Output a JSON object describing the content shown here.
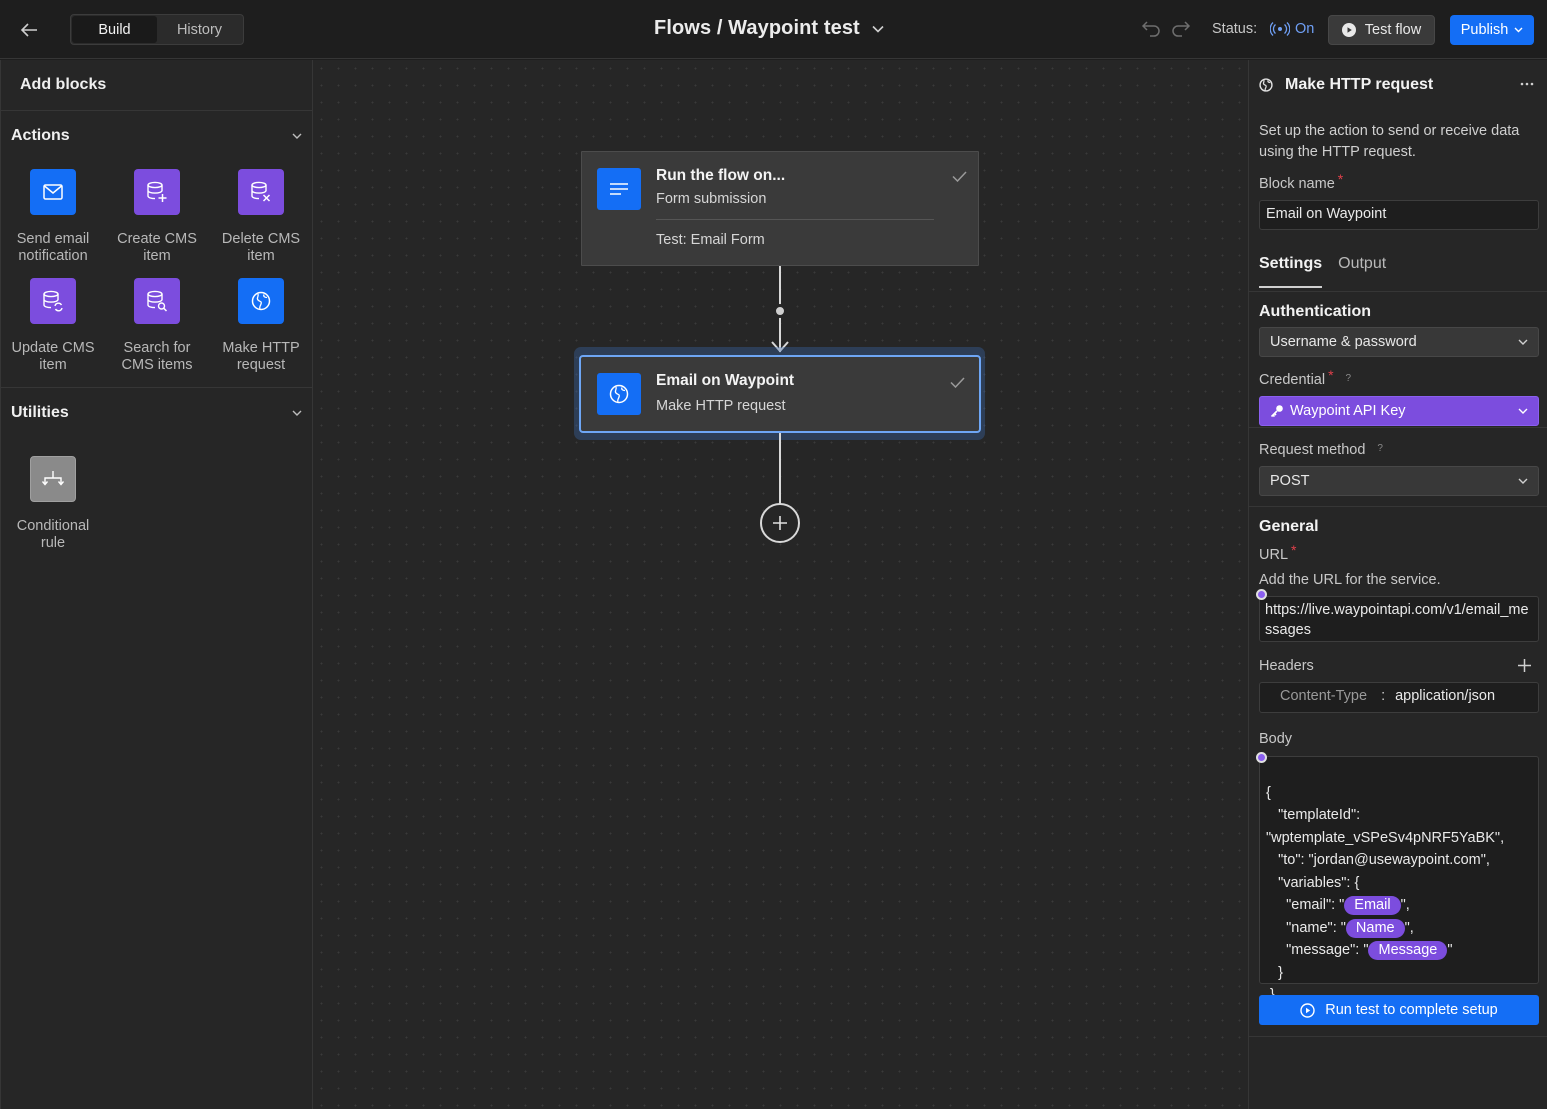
{
  "header": {
    "back_icon": "arrow-left-icon",
    "segments": [
      "Build",
      "History"
    ],
    "active_segment": "Build",
    "title": "Flows / Waypoint test",
    "status_label": "Status:",
    "status_value": "On",
    "test_flow_label": "Test flow",
    "publish_label": "Publish",
    "colors": {
      "accent_blue": "#146ef5",
      "status_on": "#6f9ff5"
    }
  },
  "left_panel": {
    "title": "Add blocks",
    "sections": [
      {
        "title": "Actions",
        "items": [
          {
            "label": "Send email notification",
            "icon": "mail-icon",
            "color": "#146ef5"
          },
          {
            "label": "Create CMS item",
            "icon": "database-plus-icon",
            "color": "#7c4dde"
          },
          {
            "label": "Delete CMS item",
            "icon": "database-x-icon",
            "color": "#7c4dde"
          },
          {
            "label": "Update CMS item",
            "icon": "database-refresh-icon",
            "color": "#7c4dde"
          },
          {
            "label": "Search for CMS items",
            "icon": "database-search-icon",
            "color": "#7c4dde"
          },
          {
            "label": "Make HTTP request",
            "icon": "globe-icon",
            "color": "#146ef5"
          }
        ]
      },
      {
        "title": "Utilities",
        "items": [
          {
            "label": "Conditional rule",
            "icon": "branch-icon",
            "color": "#8a8a8a"
          }
        ]
      }
    ]
  },
  "canvas": {
    "trigger_node": {
      "title": "Run the flow on...",
      "subtitle": "Form submission",
      "detail": "Test: Email Form"
    },
    "action_node": {
      "title": "Email on Waypoint",
      "subtitle": "Make HTTP request"
    }
  },
  "right_panel": {
    "title": "Make HTTP request",
    "description": "Set up the action to send or receive data using the HTTP request.",
    "block_name_label": "Block name",
    "block_name_value": "Email on Waypoint",
    "tabs": [
      "Settings",
      "Output"
    ],
    "active_tab": "Settings",
    "authentication": {
      "title": "Authentication",
      "selected": "Username & password"
    },
    "credential": {
      "label": "Credential",
      "help": "?",
      "selected": "Waypoint API Key"
    },
    "request_method": {
      "label": "Request method",
      "help": "?",
      "selected": "POST"
    },
    "general": {
      "title": "General",
      "url_label": "URL",
      "url_hint": "Add the URL for the service.",
      "url_value": "https://live.waypointapi.com/v1/email_messages",
      "headers_label": "Headers",
      "header_key": "Content-Type",
      "header_sep": ":",
      "header_value": "application/json",
      "body_label": "Body",
      "body": {
        "l1": "{",
        "l2": "   \"templateId\":",
        "l3": "\"wptemplate_vSPeSv4pNRF5YaBK\",",
        "l4": "   \"to\": \"jordan@usewaypoint.com\",",
        "l5": "   \"variables\": {",
        "email_pre": "     \"email\": \"",
        "email_var": "Email",
        "email_post": "\",",
        "name_pre": "     \"name\": \"",
        "name_var": "Name",
        "name_post": "\",",
        "msg_pre": "     \"message\": \"",
        "msg_var": "Message",
        "msg_post": "\"",
        "l9": "   }",
        "l10": " }"
      }
    },
    "run_button_label": "Run test to complete setup"
  }
}
